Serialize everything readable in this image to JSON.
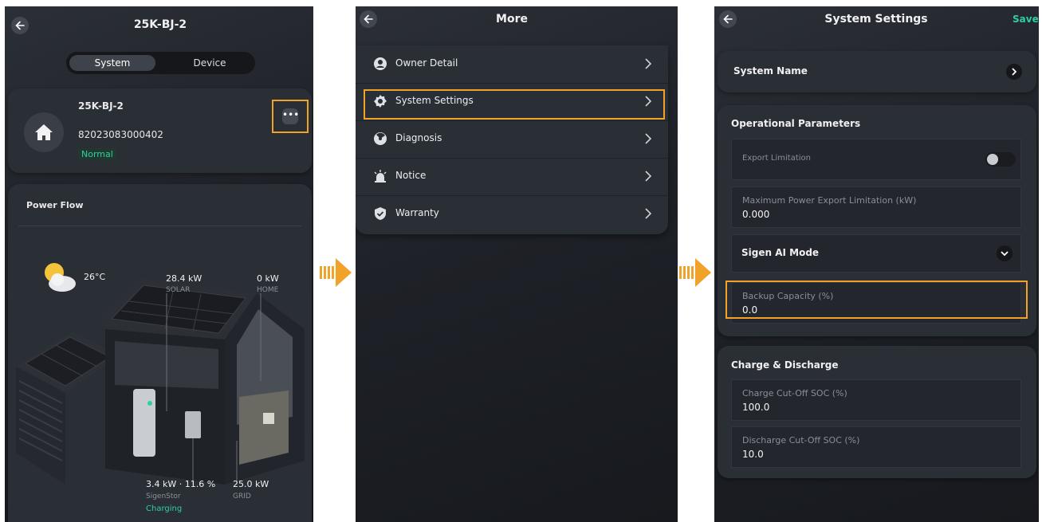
{
  "panel1": {
    "title": "25K-BJ-2",
    "tabs": [
      "System",
      "Device"
    ],
    "site": {
      "name": "25K-BJ-2",
      "id": "82023083000402",
      "status": "Normal"
    },
    "power_flow": {
      "title": "Power Flow",
      "temperature": "26°C",
      "solar": {
        "value": "28.4 kW",
        "label": "SOLAR"
      },
      "home": {
        "value": "0 kW",
        "label": "HOME"
      },
      "battery": {
        "value": "3.4 kW · 11.6 %",
        "label": "SigenStor",
        "state": "Charging"
      },
      "grid": {
        "value": "25.0 kW",
        "label": "GRID"
      }
    }
  },
  "panel2": {
    "title": "More",
    "items": [
      {
        "label": "Owner Detail",
        "icon": "person-icon"
      },
      {
        "label": "System Settings",
        "icon": "gear-icon"
      },
      {
        "label": "Diagnosis",
        "icon": "diagnosis-icon"
      },
      {
        "label": "Notice",
        "icon": "alarm-icon"
      },
      {
        "label": "Warranty",
        "icon": "shield-icon"
      }
    ]
  },
  "panel3": {
    "title": "System Settings",
    "save": "Save",
    "system_name": "System Name",
    "operational": {
      "title": "Operational Parameters",
      "export_limitation": "Export Limitation",
      "max_export": {
        "label": "Maximum Power Export Limitation (kW)",
        "value": "0.000"
      },
      "ai_mode": "Sigen AI Mode",
      "backup": {
        "label": "Backup Capacity (%)",
        "value": "0.0"
      }
    },
    "charge": {
      "title": "Charge & Discharge",
      "charge_cutoff": {
        "label": "Charge Cut-Off SOC (%)",
        "value": "100.0"
      },
      "discharge_cutoff": {
        "label": "Discharge Cut-Off SOC (%)",
        "value": "10.0"
      }
    }
  },
  "colors": {
    "accent": "#f0a229",
    "green": "#2ecfa1",
    "panel": "#2a2e35",
    "background": "#1e2127"
  }
}
